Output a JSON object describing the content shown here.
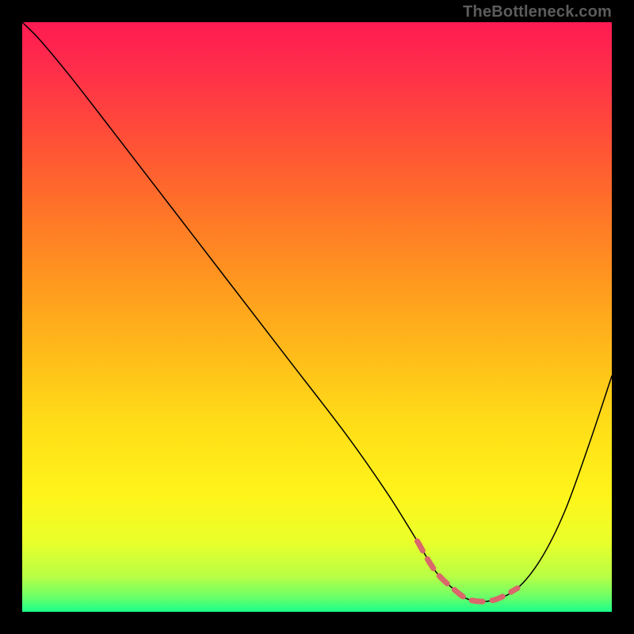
{
  "watermark": "TheBottleneck.com",
  "gradient": {
    "stops": [
      {
        "offset": 0.0,
        "color": "#ff1a52"
      },
      {
        "offset": 0.08,
        "color": "#ff2e4a"
      },
      {
        "offset": 0.18,
        "color": "#ff4a3a"
      },
      {
        "offset": 0.3,
        "color": "#ff6e2a"
      },
      {
        "offset": 0.42,
        "color": "#ff9220"
      },
      {
        "offset": 0.55,
        "color": "#ffb81a"
      },
      {
        "offset": 0.68,
        "color": "#ffdd18"
      },
      {
        "offset": 0.8,
        "color": "#fff41a"
      },
      {
        "offset": 0.88,
        "color": "#eaff2a"
      },
      {
        "offset": 0.94,
        "color": "#b8ff45"
      },
      {
        "offset": 0.975,
        "color": "#6bff68"
      },
      {
        "offset": 1.0,
        "color": "#1aff8a"
      }
    ]
  },
  "chart_data": {
    "type": "line",
    "title": "",
    "xlabel": "",
    "ylabel": "",
    "xlim": [
      0,
      100
    ],
    "ylim": [
      0,
      100
    ],
    "series": [
      {
        "name": "bottleneck-curve",
        "color": "#000000",
        "width": 1.5,
        "x": [
          0,
          3,
          8,
          15,
          25,
          35,
          45,
          55,
          62,
          67,
          70,
          73,
          76,
          80,
          84,
          88,
          92,
          96,
          100
        ],
        "y": [
          100,
          97,
          91,
          82,
          69,
          56,
          43,
          30,
          20,
          12,
          7,
          4,
          2,
          2,
          4,
          9,
          17,
          28,
          40
        ]
      },
      {
        "name": "optimal-range",
        "color": "#d9676b",
        "width": 7,
        "style": "dashed",
        "x": [
          67,
          70,
          73,
          76,
          80,
          84
        ],
        "y": [
          12,
          7,
          4,
          2,
          2,
          4
        ]
      }
    ]
  }
}
